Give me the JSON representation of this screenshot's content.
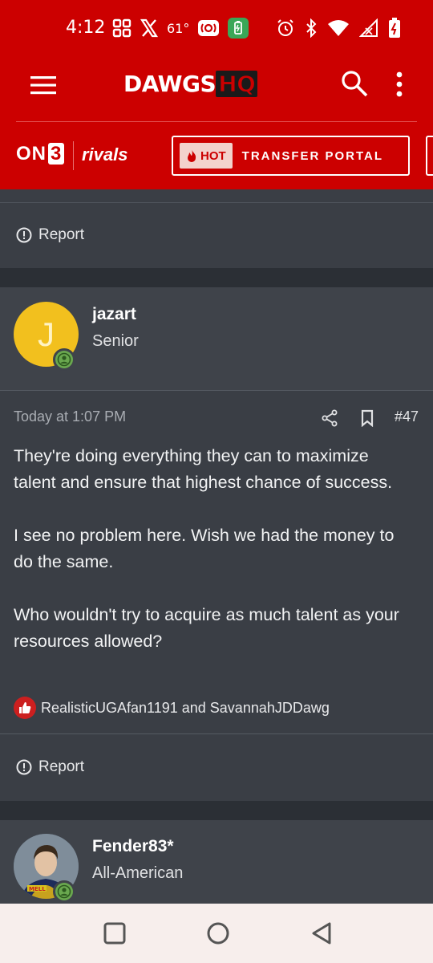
{
  "status_bar": {
    "time": "4:12",
    "temperature": "61°",
    "icons": [
      "grid-icon",
      "x-logo-icon",
      "radio-icon",
      "battery-saver-icon",
      "alarm-icon",
      "bluetooth-icon",
      "wifi-icon",
      "signal-icon",
      "battery-icon"
    ]
  },
  "app_bar": {
    "logo_main": "DAWGS",
    "logo_accent": "HQ",
    "icons": [
      "menu-icon",
      "search-icon",
      "more-vert-icon"
    ]
  },
  "sub_bar": {
    "on3_prefix": "ON",
    "on3_suffix": "3",
    "rivals": "rivals",
    "hot_label": "HOT",
    "portal_label": "TRANSFER PORTAL"
  },
  "previous_post": {
    "report_label": "Report"
  },
  "post": {
    "author_initial": "J",
    "author_name": "jazart",
    "author_title": "Senior",
    "date": "Today at 1:07 PM",
    "post_number": "#47",
    "paragraphs": [
      "They're doing everything they can to maximize talent and ensure that highest chance of success.",
      "I see no problem here. Wish we had the money to do the same.",
      "Who wouldn't try to acquire as much talent as your resources allowed?"
    ],
    "reactions_text": "RealisticUGAfan1191 and SavannahJDDawg",
    "report_label": "Report"
  },
  "next_post": {
    "author_name": "Fender83*",
    "author_title": "All-American",
    "avatar_badge_text": "MELL"
  },
  "colors": {
    "brand_red": "#cc0000",
    "card_bg": "#3a3e45",
    "online_green": "#6aa84f"
  }
}
